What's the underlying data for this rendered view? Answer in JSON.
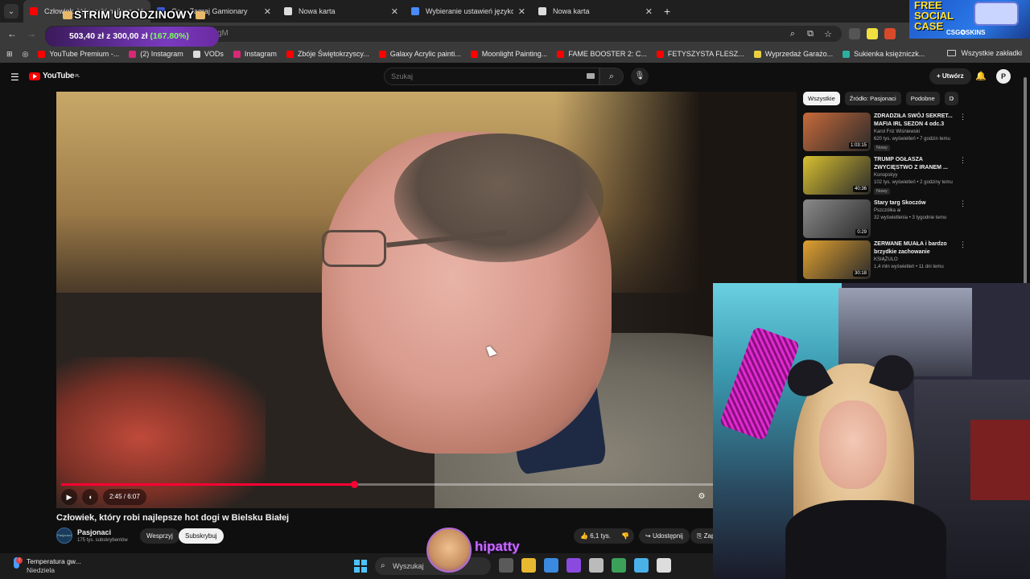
{
  "browser": {
    "tabs": [
      {
        "label": "Człowiek, który robi najlepsze hot dogi w Bielsku Białej",
        "color": "#ff0000",
        "active": true
      },
      {
        "label": "Gry - Zagraj Gamionary",
        "color": "#3a5ad8",
        "active": false
      },
      {
        "label": "Nowa karta",
        "color": "#dddddd",
        "active": false
      },
      {
        "label": "Wybieranie ustawień językowych",
        "color": "#4a8aff",
        "active": false
      },
      {
        "label": "Nowa karta",
        "color": "#dddddd",
        "active": false
      }
    ],
    "address_text": "gM",
    "bookmarks": [
      {
        "label": "YouTube Premium -...",
        "color": "#ff0000"
      },
      {
        "label": "(2) Instagram",
        "color": "#d62976"
      },
      {
        "label": "VODs",
        "color": "#dddddd"
      },
      {
        "label": "Instagram",
        "color": "#d62976"
      },
      {
        "label": "Zbóje Świętokrzyscy...",
        "color": "#ff0000"
      },
      {
        "label": "Galaxy Acrylic painti...",
        "color": "#ff0000"
      },
      {
        "label": "Moonlight Painting...",
        "color": "#ff0000"
      },
      {
        "label": "FAME BOOSTER 2: C...",
        "color": "#ff0000"
      },
      {
        "label": "FETYSZYSTA FLESZ...",
        "color": "#ff0000"
      },
      {
        "label": "Wyprzedaż Garażo...",
        "color": "#e8d040"
      },
      {
        "label": "Sukienka księżniczk...",
        "color": "#2ab0a0"
      }
    ],
    "all_bookmarks": "Wszystkie zakładki"
  },
  "youtube": {
    "logo": "YouTube",
    "logo_region": "PL",
    "search_placeholder": "Szukaj",
    "create_label": "Utwórz",
    "avatar_letter": "P",
    "video": {
      "title": "Człowiek, który robi najlepsze hot dogi w Bielsku Białej",
      "time": "2:45 / 6:07",
      "progress": 0.4496,
      "channel": "Pasjonaci",
      "channel_avatar": "Pasjonaci",
      "subscribers": "175 tys. subskrybentów",
      "support_label": "Wesprzyj",
      "subscribe_label": "Subskrybuj",
      "likes": "6,1 tys.",
      "share_label": "Udostępnij",
      "save_label": "Zapisz"
    },
    "chips": [
      "Wszystkie",
      "Źródło: Pasjonaci",
      "Podobne",
      "D"
    ],
    "recommendations": [
      {
        "title": "ZDRADZIŁA SWÓJ SEKRET... MAFIA IRL SEZON 4 odc.3",
        "channel": "Karol Friz Wiśniewski",
        "meta": "620 tys. wyświetleń • 7 godzin temu",
        "badge": "Nowy",
        "duration": "1:03:15",
        "thumb": "#c86a3a"
      },
      {
        "title": "TRUMP OGŁASZA ZWYCIĘSTWO Z IRANEM ...",
        "channel": "Konopskyy",
        "meta": "102 tys. wyświetleń • 2 godziny temu",
        "badge": "Nowy",
        "duration": "40:36",
        "thumb": "#d8c030"
      },
      {
        "title": "Stary targ Skoczów",
        "channel": "Pszczółka ai",
        "meta": "32 wyświetlenia • 3 tygodnie temu",
        "badge": "",
        "duration": "0:29",
        "thumb": "#8a8a8a"
      },
      {
        "title": "ZERWANE MUAŁA i bardzo brzydkie zachowanie",
        "channel": "KSIĄŻULO",
        "meta": "1,4 mln wyświetleń • 11 dni temu",
        "badge": "",
        "duration": "30:18",
        "thumb": "#e0a030"
      }
    ]
  },
  "overlay": {
    "strim": "STRIM URODZINOWY",
    "donation_amount": "503,40 zł z 300,00 zł",
    "donation_percent": "(167.80%)",
    "promo_line1": "FREE",
    "promo_line2": "SOCIAL",
    "promo_line3": "CASE",
    "promo_brand": "CSG✪SKINS",
    "streamer_name": "hipatty"
  },
  "taskbar": {
    "weather_title": "Temperatura gw...",
    "weather_day": "Niedziela",
    "warning_count": "!",
    "search_label": "Wyszukaj",
    "apps": [
      {
        "name": "task-view",
        "color": "#5a5a5a"
      },
      {
        "name": "explorer",
        "color": "#e8b830"
      },
      {
        "name": "store",
        "color": "#3a8ae0"
      },
      {
        "name": "app-purple",
        "color": "#8a4ae0"
      },
      {
        "name": "app-sync",
        "color": "#bbbbbb"
      },
      {
        "name": "chrome",
        "color": "#3aa05a"
      },
      {
        "name": "notepad",
        "color": "#4ab0e8"
      },
      {
        "name": "app-wave",
        "color": "#dddddd"
      }
    ]
  }
}
